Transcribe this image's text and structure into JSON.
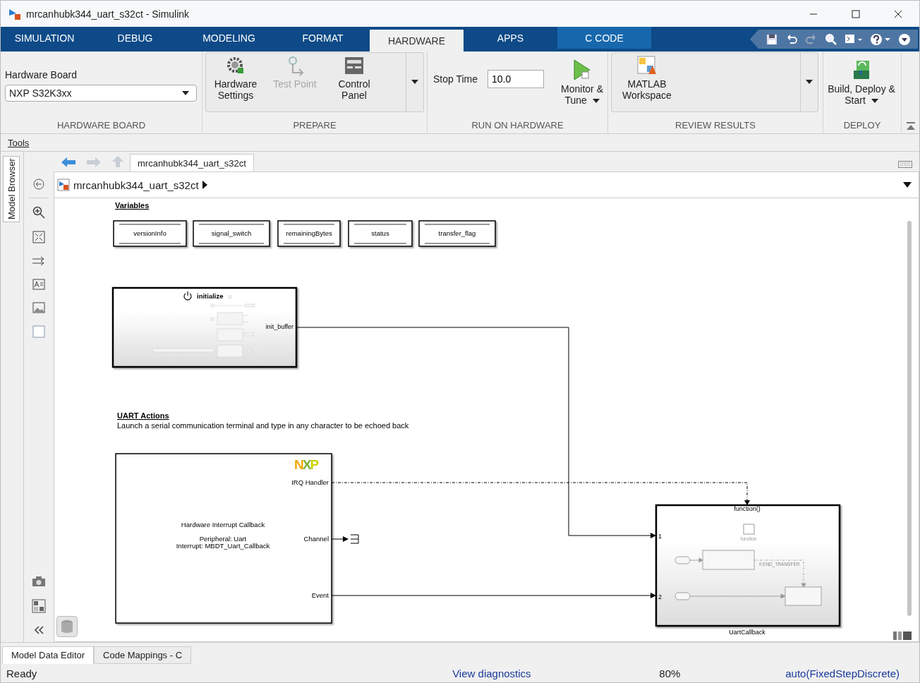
{
  "window": {
    "title": "mrcanhubk344_uart_s32ct - Simulink"
  },
  "tabs": [
    {
      "label": "SIMULATION",
      "selected": false,
      "contextual": false
    },
    {
      "label": "DEBUG",
      "selected": false,
      "contextual": false
    },
    {
      "label": "MODELING",
      "selected": false,
      "contextual": false
    },
    {
      "label": "FORMAT",
      "selected": false,
      "contextual": false
    },
    {
      "label": "HARDWARE",
      "selected": true,
      "contextual": false
    },
    {
      "label": "APPS",
      "selected": false,
      "contextual": false
    },
    {
      "label": "C CODE",
      "selected": false,
      "contextual": true
    }
  ],
  "ribbon": {
    "hardware_board": {
      "label": "Hardware Board",
      "value": "NXP S32K3xx",
      "section": "HARDWARE BOARD"
    },
    "prepare": {
      "section": "PREPARE",
      "buttons": [
        {
          "label": "Hardware Settings",
          "kind": "gear",
          "disabled": false
        },
        {
          "label": "Test Point",
          "kind": "probe",
          "disabled": true
        },
        {
          "label": "Control Panel",
          "kind": "panel",
          "disabled": false
        }
      ]
    },
    "run": {
      "section": "RUN ON HARDWARE",
      "stop_time_label": "Stop Time",
      "stop_time": "10.0",
      "button": "Monitor & Tune"
    },
    "review": {
      "section": "REVIEW RESULTS",
      "button": "MATLAB Workspace"
    },
    "deploy": {
      "section": "DEPLOY",
      "button": "Build, Deploy & Start"
    }
  },
  "tools_label": "Tools",
  "side_tab": "Model Browser",
  "model_tab": "mrcanhubk344_uart_s32ct",
  "breadcrumb": "mrcanhubk344_uart_s32ct",
  "diagram": {
    "variables_title": "Variables",
    "variables": [
      "versionInfo",
      "signal_switch",
      "remainingBytes",
      "status",
      "transfer_flag"
    ],
    "init_block": {
      "title": "initialize",
      "port": "init_buffer"
    },
    "uart_title": "UART Actions",
    "uart_description": "Launch a serial communication terminal and type in any character to be echoed back",
    "callback_block": {
      "logo": "NXP",
      "lines": [
        "Hardware Interrupt Callback",
        "Peripheral: Uart",
        "Interrupt: MBDT_Uart_Callback"
      ],
      "ports": [
        "IRQ Handler",
        "Channel",
        "Event"
      ]
    },
    "uart_callback": {
      "trigger": "function()",
      "inputs": [
        "1",
        "2"
      ],
      "trigger_label": "function",
      "condition": "if END_TRANSFER",
      "name": "UartCallback"
    }
  },
  "bottom_tabs": [
    {
      "label": "Model Data Editor",
      "selected": true
    },
    {
      "label": "Code Mappings - C",
      "selected": false
    }
  ],
  "status": {
    "state": "Ready",
    "link": "View diagnostics",
    "zoom": "80%",
    "solver": "auto(FixedStepDiscrete)"
  }
}
